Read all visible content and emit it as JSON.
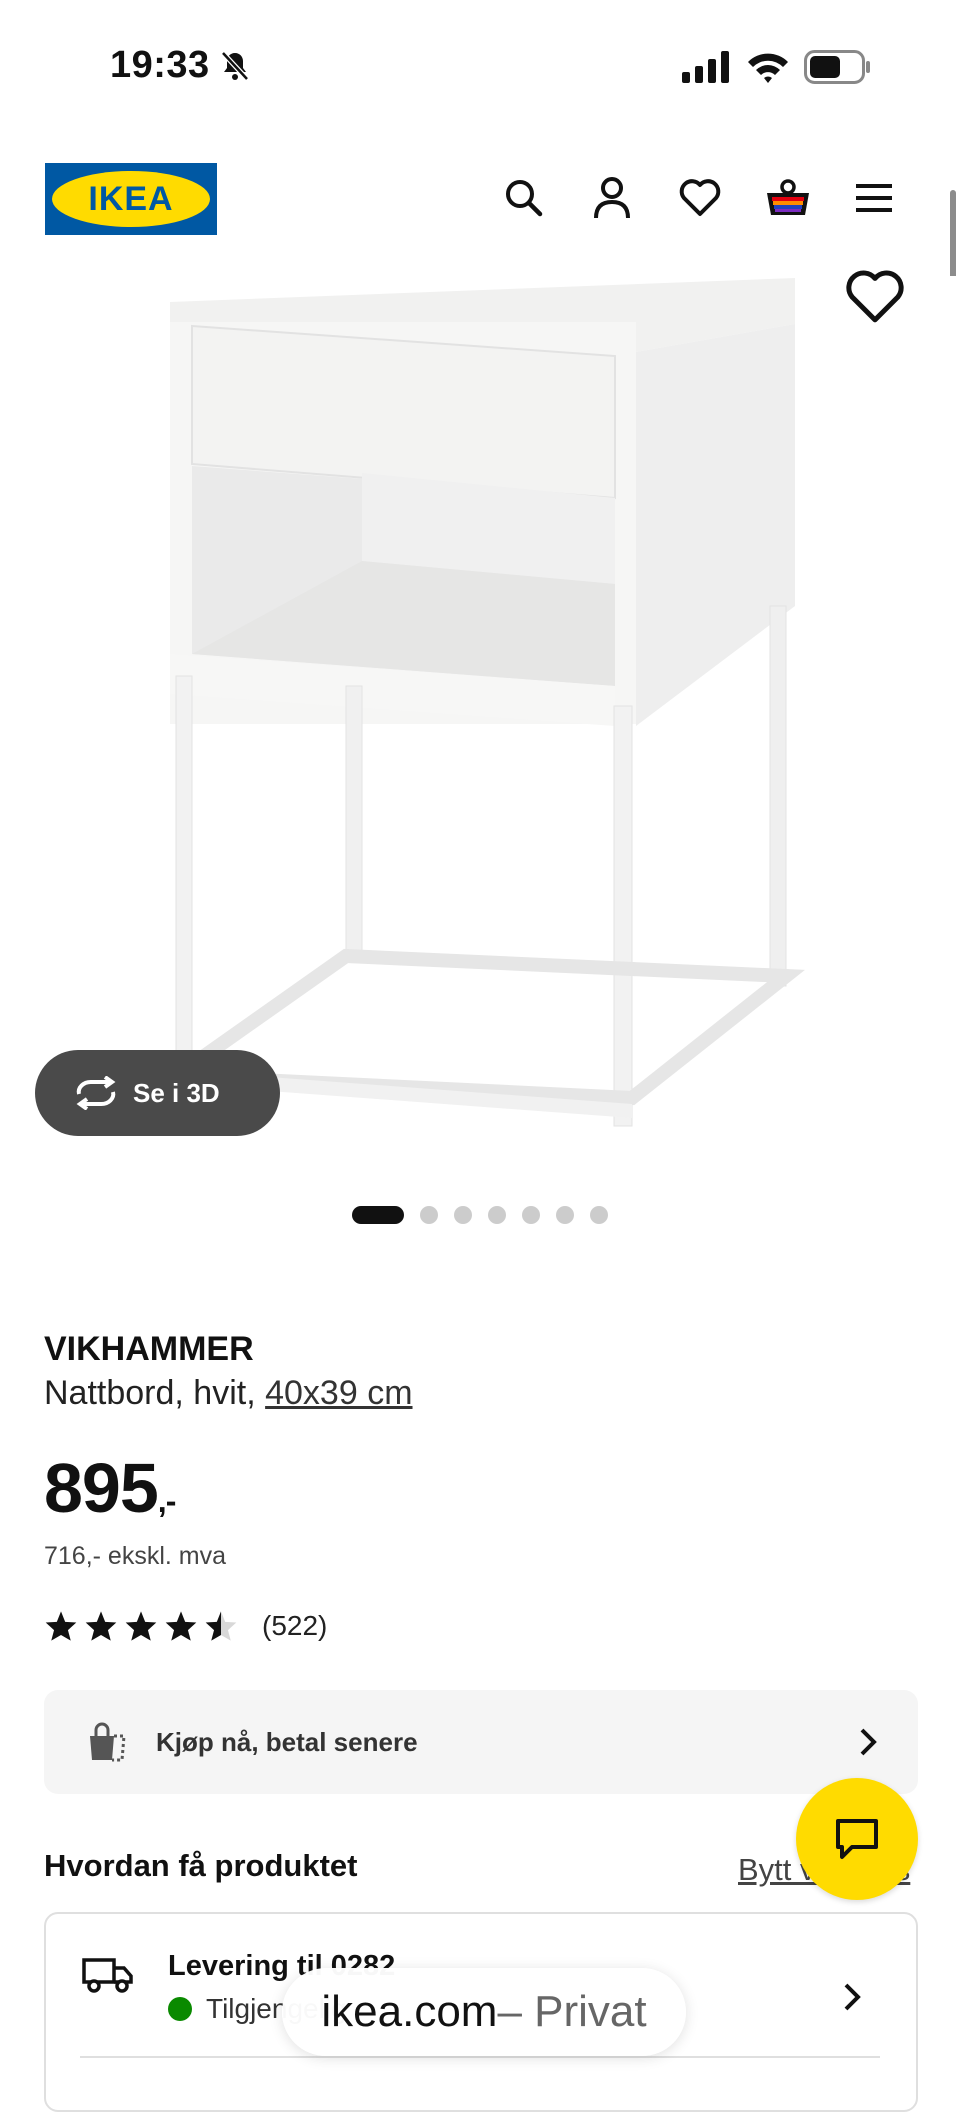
{
  "status_bar": {
    "time": "19:33"
  },
  "header": {
    "logo_text": "IKEA",
    "icons": [
      "search-icon",
      "user-icon",
      "heart-icon",
      "cart-icon",
      "menu-icon"
    ]
  },
  "gallery": {
    "view_3d_label": "Se i 3D",
    "image_count": 7,
    "active_index": 0
  },
  "product": {
    "name": "VIKHAMMER",
    "description": "Nattbord, hvit,",
    "dimension": "40x39 cm",
    "price": "895",
    "price_suffix": ",-",
    "price_ex_vat": "716,- ekskl. mva",
    "rating": 4.5,
    "rating_count": "(522)"
  },
  "pay_later": {
    "label": "Kjøp nå, betal senere"
  },
  "delivery": {
    "section_title": "Hvordan få produktet",
    "change_link": "Bytt varehus",
    "delivery_title": "Levering til 0282",
    "availability": "Tilgjengelig"
  },
  "url_bar": {
    "domain": "ikea.com",
    "suffix": " – Privat"
  },
  "colors": {
    "ikea_blue": "#0058a3",
    "ikea_yellow": "#ffdb00",
    "available_green": "#0a8a00"
  }
}
